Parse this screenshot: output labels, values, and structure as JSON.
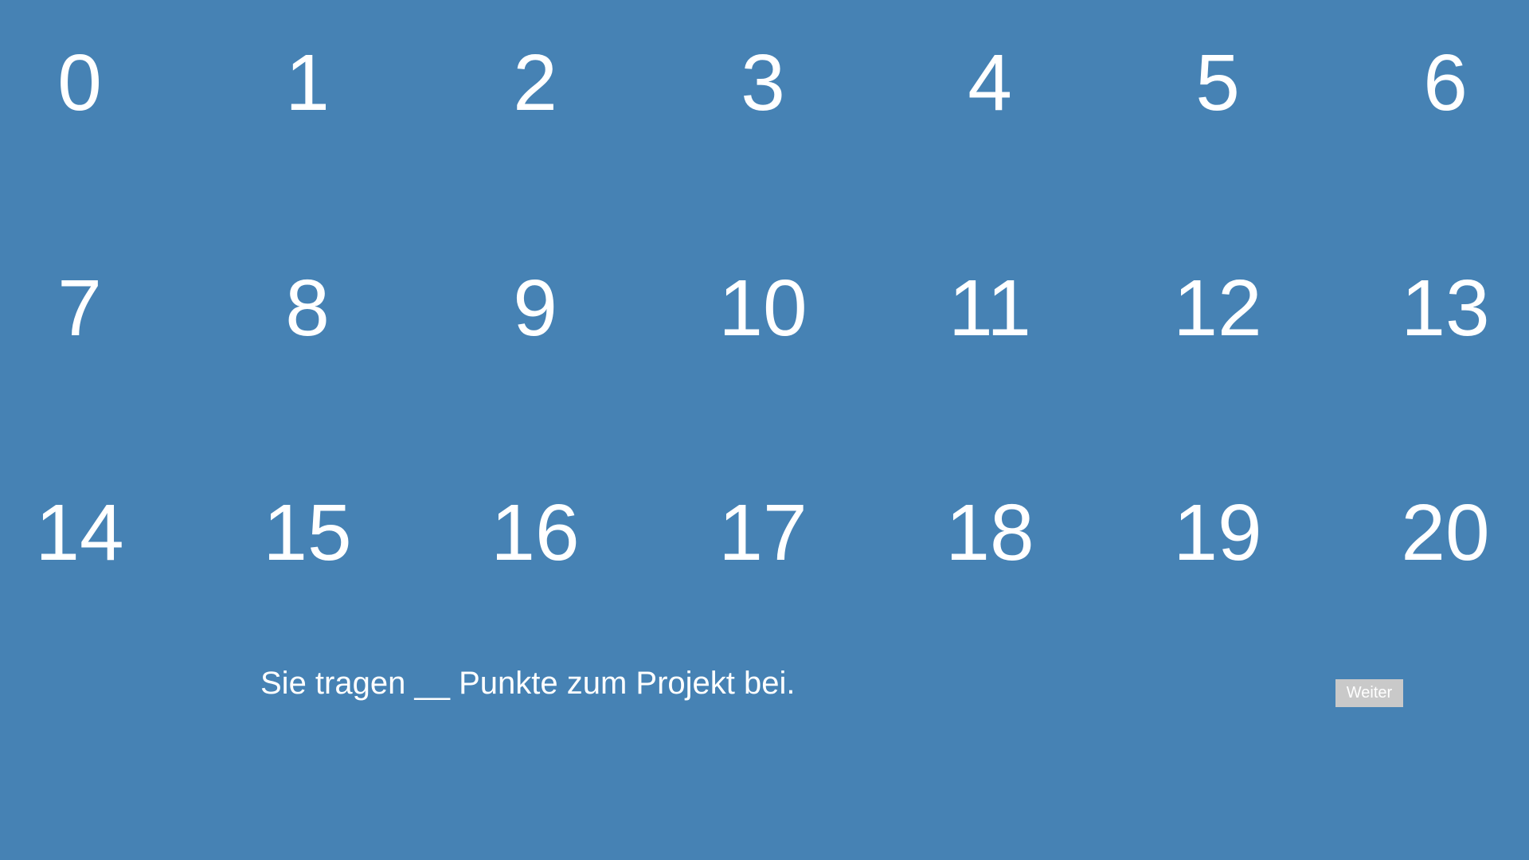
{
  "background_color": "#4682b4",
  "text_color": "#ffffff",
  "numbers": [
    "0",
    "1",
    "2",
    "3",
    "4",
    "5",
    "6",
    "7",
    "8",
    "9",
    "10",
    "11",
    "12",
    "13",
    "14",
    "15",
    "16",
    "17",
    "18",
    "19",
    "20"
  ],
  "prompt": "Sie tragen __ Punkte zum Projekt bei.",
  "next_button": {
    "label": "Weiter",
    "color": "#c9c9c9"
  }
}
